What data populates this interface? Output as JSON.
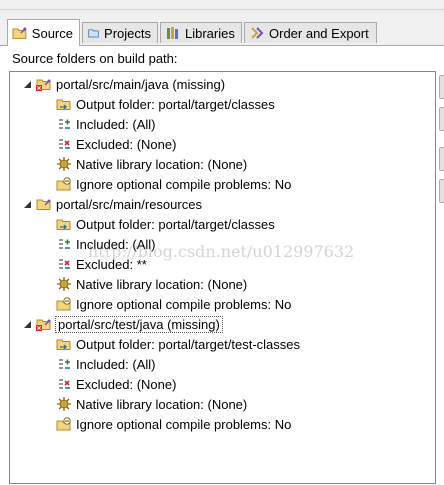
{
  "tabs": [
    {
      "label": "Source",
      "icon": "source-folder-icon",
      "active": true
    },
    {
      "label": "Projects",
      "icon": "projects-icon",
      "active": false
    },
    {
      "label": "Libraries",
      "icon": "libraries-icon",
      "active": false
    },
    {
      "label": "Order and Export",
      "icon": "order-export-icon",
      "active": false
    }
  ],
  "section_label": "Source folders on build path:",
  "watermark": "http://blog.csdn.net/u012997632",
  "tree": [
    {
      "label": "portal/src/main/java (missing)",
      "missing": true,
      "children": [
        {
          "icon": "output-folder-icon",
          "label": "Output folder: portal/target/classes"
        },
        {
          "icon": "included-icon",
          "label": "Included: (All)"
        },
        {
          "icon": "excluded-icon",
          "label": "Excluded: (None)"
        },
        {
          "icon": "native-library-icon",
          "label": "Native library location: (None)"
        },
        {
          "icon": "ignore-problems-icon",
          "label": "Ignore optional compile problems: No"
        }
      ]
    },
    {
      "label": "portal/src/main/resources",
      "missing": false,
      "children": [
        {
          "icon": "output-folder-icon",
          "label": "Output folder: portal/target/classes"
        },
        {
          "icon": "included-icon",
          "label": "Included: (All)"
        },
        {
          "icon": "excluded-icon",
          "label": "Excluded: **"
        },
        {
          "icon": "native-library-icon",
          "label": "Native library location: (None)"
        },
        {
          "icon": "ignore-problems-icon",
          "label": "Ignore optional compile problems: No"
        }
      ]
    },
    {
      "label": "portal/src/test/java (missing)",
      "missing": true,
      "selected": true,
      "children": [
        {
          "icon": "output-folder-icon",
          "label": "Output folder: portal/target/test-classes"
        },
        {
          "icon": "included-icon",
          "label": "Included: (All)"
        },
        {
          "icon": "excluded-icon",
          "label": "Excluded: (None)"
        },
        {
          "icon": "native-library-icon",
          "label": "Native library location: (None)"
        },
        {
          "icon": "ignore-problems-icon",
          "label": "Ignore optional compile problems: No"
        }
      ]
    }
  ]
}
